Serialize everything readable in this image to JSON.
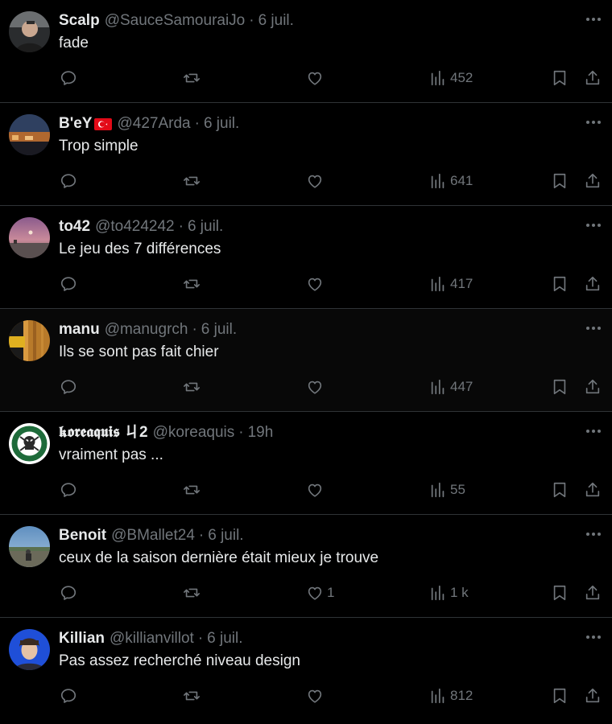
{
  "colors": {
    "background": "#000000",
    "text_primary": "#e7e9ea",
    "text_secondary": "#71767b",
    "divider": "#2f3336"
  },
  "icons": {
    "reply": "reply-icon",
    "retweet": "retweet-icon",
    "like": "heart-icon",
    "views": "views-icon",
    "bookmark": "bookmark-icon",
    "share": "share-icon",
    "more": "more-icon"
  },
  "tweets": [
    {
      "name": "Scalp",
      "handle": "@SauceSamouraiJo",
      "time": "6 juil.",
      "text": "fade",
      "likes": "",
      "views": "452"
    },
    {
      "name": "B'eY",
      "flag": "flag-turkey",
      "handle": "@427Arda",
      "time": "6 juil.",
      "text": "Trop simple",
      "likes": "",
      "views": "641"
    },
    {
      "name": "to42",
      "handle": "@to424242",
      "time": "6 juil.",
      "text": "Le jeu des 7 différences",
      "likes": "",
      "views": "417"
    },
    {
      "name": "manu",
      "handle": "@manugrch",
      "time": "6 juil.",
      "text": "Ils se sont pas fait chier",
      "likes": "",
      "views": "447"
    },
    {
      "name": "𝖐𝖔𝖗𝖊𝖆𝖖𝖚𝖎𝖘 ㄐ2",
      "handle": "@koreaquis",
      "time": "19h",
      "text": "vraiment pas ...",
      "likes": "",
      "views": "55"
    },
    {
      "name": "Benoit",
      "handle": "@BMallet24",
      "time": "6 juil.",
      "text": "ceux de la saison dernière était mieux je trouve",
      "likes": "1",
      "views": "1 k"
    },
    {
      "name": "Killian",
      "handle": "@killianvillot",
      "time": "6 juil.",
      "text": "Pas assez recherché niveau design",
      "likes": "",
      "views": "812"
    }
  ]
}
